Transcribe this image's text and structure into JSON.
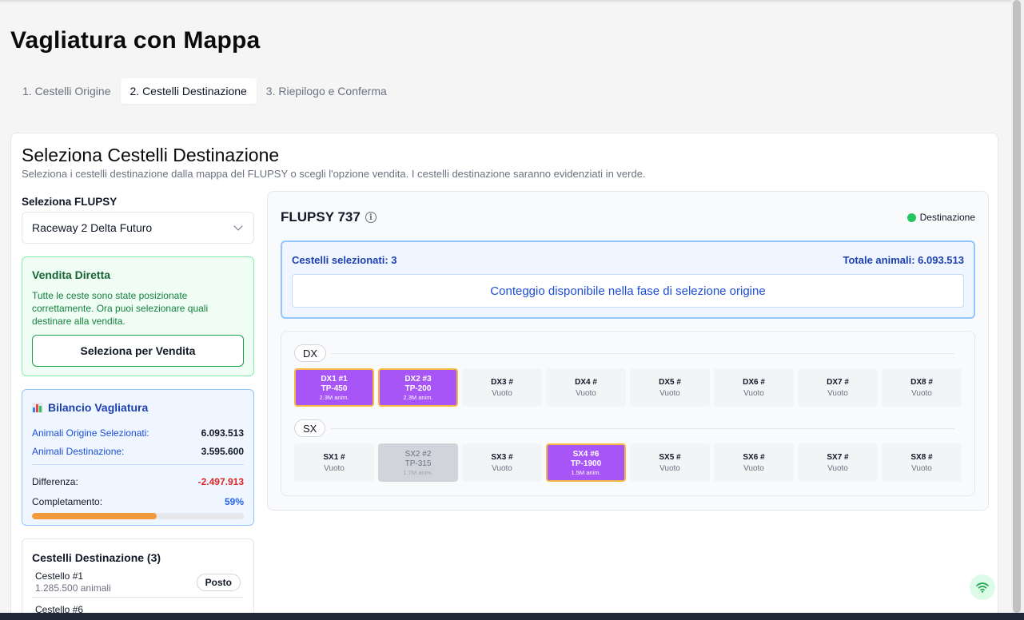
{
  "page_title": "Vagliatura con Mappa",
  "tabs": [
    {
      "label": "1. Cestelli Origine"
    },
    {
      "label": "2. Cestelli Destinazione"
    },
    {
      "label": "3. Riepilogo e Conferma"
    }
  ],
  "section": {
    "title": "Seleziona Cestelli Destinazione",
    "description": "Seleziona i cestelli destinazione dalla mappa del FLUPSY o scegli l'opzione vendita. I cestelli destinazione saranno evidenziati in verde."
  },
  "flupsy_select": {
    "label": "Seleziona FLUPSY",
    "value": "Raceway 2 Delta Futuro"
  },
  "vendita": {
    "title": "Vendita Diretta",
    "text": "Tutte le ceste sono state posizionate correttamente. Ora puoi selezionare quali destinare alla vendita.",
    "button": "Seleziona per Vendita"
  },
  "bilancio": {
    "title": "Bilancio Vagliatura",
    "rows": [
      {
        "label": "Animali Origine Selezionati:",
        "value": "6.093.513"
      },
      {
        "label": "Animali Destinazione:",
        "value": "3.595.600"
      },
      {
        "label": "Differenza:",
        "value": "-2.497.913"
      },
      {
        "label": "Completamento:",
        "value": "59%"
      }
    ],
    "progress_fraction": 0.59,
    "colors": {
      "negative": "#dc2626",
      "progress": "#f39a3c"
    }
  },
  "destinazione": {
    "title": "Cestelli Destinazione (3)",
    "items": [
      {
        "name": "Cestello #1",
        "animals": "1.285.500 animali",
        "button": "Posto"
      },
      {
        "name": "Cestello #6",
        "animals": "",
        "button": ""
      }
    ]
  },
  "flupsy": {
    "title": "FLUPSY 737",
    "legend_label": "Destinazione",
    "legend_color": "#22c55e",
    "selected_count": "Cestelli selezionati: 3",
    "total_animals": "Totale animali: 6.093.513",
    "conteggio": "Conteggio disponibile nella fase di selezione origine"
  },
  "map": {
    "rows": [
      {
        "label": "DX",
        "cells": [
          {
            "id": "DX1 #1",
            "line2": "TP-450",
            "line3": "2.3M anim.",
            "state": "sel"
          },
          {
            "id": "DX2 #3",
            "line2": "TP-200",
            "line3": "2.3M anim.",
            "state": "sel"
          },
          {
            "id": "DX3 #",
            "line2": "Vuoto",
            "line3": "",
            "state": "empty"
          },
          {
            "id": "DX4 #",
            "line2": "Vuoto",
            "line3": "",
            "state": "empty"
          },
          {
            "id": "DX5 #",
            "line2": "Vuoto",
            "line3": "",
            "state": "empty"
          },
          {
            "id": "DX6 #",
            "line2": "Vuoto",
            "line3": "",
            "state": "empty"
          },
          {
            "id": "DX7 #",
            "line2": "Vuoto",
            "line3": "",
            "state": "empty"
          },
          {
            "id": "DX8 #",
            "line2": "Vuoto",
            "line3": "",
            "state": "empty"
          }
        ]
      },
      {
        "label": "SX",
        "cells": [
          {
            "id": "SX1 #",
            "line2": "Vuoto",
            "line3": "",
            "state": "empty"
          },
          {
            "id": "SX2 #2",
            "line2": "TP-315",
            "line3": "1.7M anim.",
            "state": "occ"
          },
          {
            "id": "SX3 #",
            "line2": "Vuoto",
            "line3": "",
            "state": "empty"
          },
          {
            "id": "SX4 #6",
            "line2": "TP-1900",
            "line3": "1.5M anim.",
            "state": "sel"
          },
          {
            "id": "SX5 #",
            "line2": "Vuoto",
            "line3": "",
            "state": "empty"
          },
          {
            "id": "SX6 #",
            "line2": "Vuoto",
            "line3": "",
            "state": "empty"
          },
          {
            "id": "SX7 #",
            "line2": "Vuoto",
            "line3": "",
            "state": "empty"
          },
          {
            "id": "SX8 #",
            "line2": "Vuoto",
            "line3": "",
            "state": "empty"
          }
        ]
      }
    ],
    "colors": {
      "selected": "#a855f7",
      "selected_border": "#f5b840",
      "occupied": "#d1d5db",
      "empty": "#f3f4f6"
    }
  },
  "icons": {
    "info": "info-icon",
    "chevron": "chevron-down-icon",
    "chart": "bar-chart-icon",
    "wifi": "wifi-icon"
  }
}
